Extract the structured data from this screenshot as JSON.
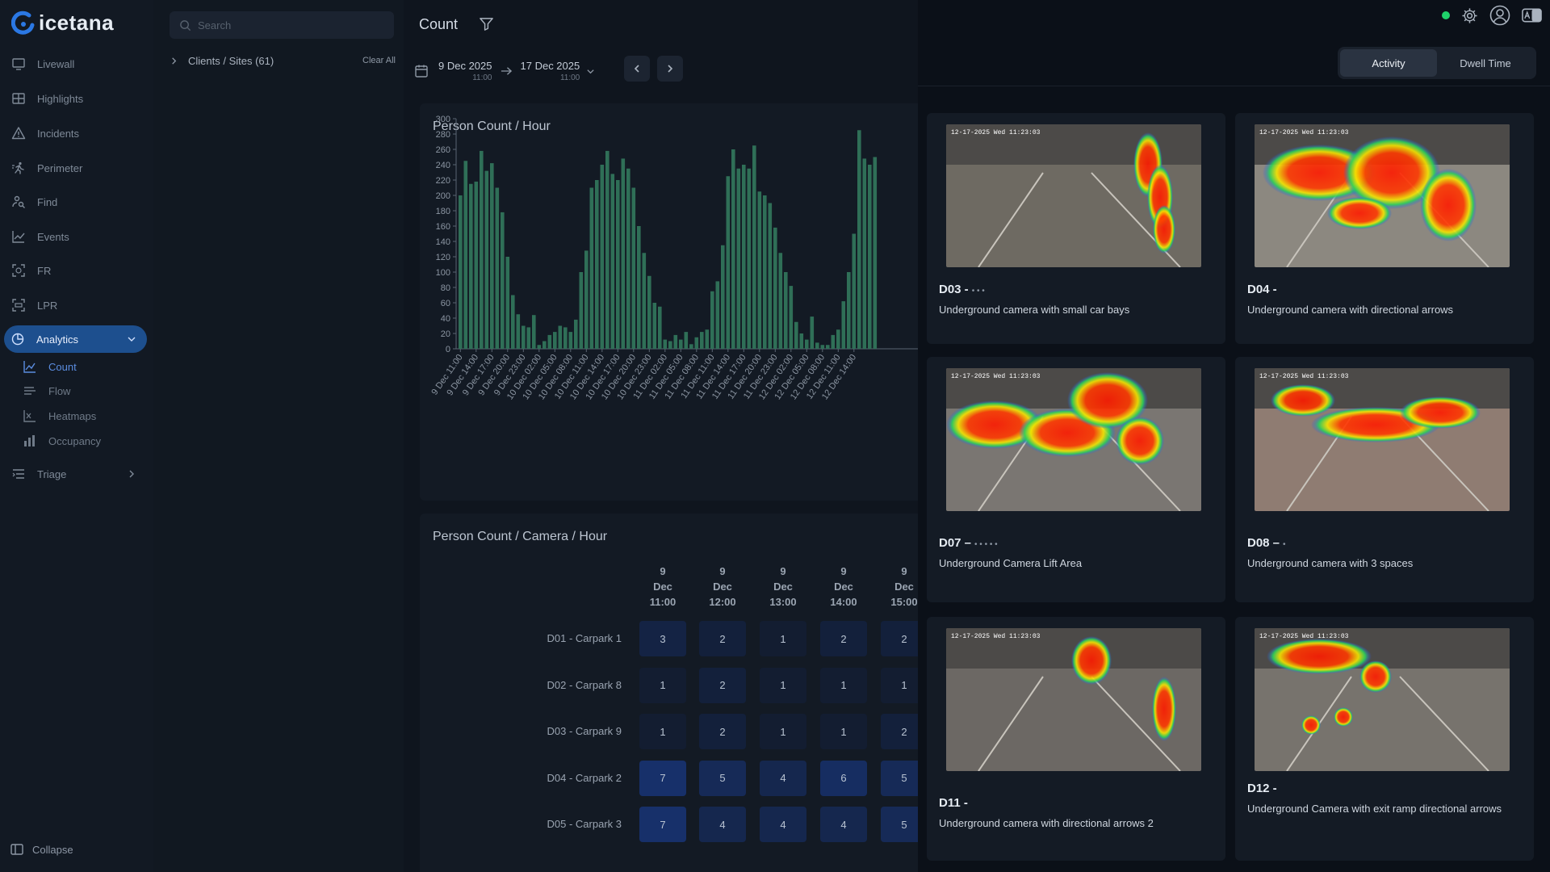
{
  "app": {
    "brand": "icetana"
  },
  "nav": {
    "items": [
      {
        "label": "Livewall",
        "icon": "monitor-icon"
      },
      {
        "label": "Highlights",
        "icon": "grid-icon"
      },
      {
        "label": "Incidents",
        "icon": "warning-icon"
      },
      {
        "label": "Perimeter",
        "icon": "person-run-icon"
      },
      {
        "label": "Find",
        "icon": "person-search-icon"
      },
      {
        "label": "Events",
        "icon": "trend-icon"
      },
      {
        "label": "FR",
        "icon": "face-scan-icon"
      },
      {
        "label": "LPR",
        "icon": "plate-scan-icon"
      },
      {
        "label": "Analytics",
        "icon": "pie-icon"
      }
    ],
    "analytics_sub": [
      {
        "label": "Count",
        "icon": "line-chart-icon"
      },
      {
        "label": "Flow",
        "icon": "flow-icon"
      },
      {
        "label": "Heatmaps",
        "icon": "heatmap-icon"
      },
      {
        "label": "Occupancy",
        "icon": "bar-chart-icon"
      }
    ],
    "triage": "Triage",
    "collapse": "Collapse"
  },
  "filters": {
    "search_placeholder": "Search",
    "clients_sites": "Clients / Sites (61)",
    "clear_all": "Clear All"
  },
  "main": {
    "title": "Count",
    "date_start": "9 Dec 2025",
    "time_start": "11:00",
    "date_end": "17 Dec 2025",
    "time_end": "11:00",
    "chart_title": "Person Count / Hour",
    "table_title": "Person Count / Camera / Hour"
  },
  "chart_data": {
    "type": "bar",
    "title": "Person Count / Hour",
    "ylim": [
      0,
      300
    ],
    "yticks": [
      0,
      20,
      40,
      60,
      80,
      100,
      120,
      140,
      160,
      180,
      200,
      220,
      240,
      260,
      280,
      300
    ],
    "x_tick_labels": [
      "9 Dec 11:00",
      "9 Dec 14:00",
      "9 Dec 17:00",
      "9 Dec 20:00",
      "9 Dec 23:00",
      "10 Dec 02:00",
      "10 Dec 05:00",
      "10 Dec 08:00",
      "10 Dec 11:00",
      "10 Dec 14:00",
      "10 Dec 17:00",
      "10 Dec 20:00",
      "10 Dec 23:00",
      "11 Dec 02:00",
      "11 Dec 05:00",
      "11 Dec 08:00",
      "11 Dec 11:00",
      "11 Dec 14:00",
      "11 Dec 17:00",
      "11 Dec 20:00",
      "11 Dec 23:00",
      "12 Dec 02:00",
      "12 Dec 05:00",
      "12 Dec 08:00",
      "12 Dec 11:00",
      "12 Dec 14:00"
    ],
    "values": [
      200,
      245,
      215,
      218,
      258,
      232,
      242,
      210,
      178,
      120,
      70,
      45,
      30,
      28,
      44,
      5,
      10,
      18,
      22,
      30,
      28,
      22,
      38,
      100,
      128,
      210,
      220,
      240,
      258,
      228,
      220,
      248,
      235,
      210,
      160,
      125,
      95,
      60,
      55,
      12,
      10,
      18,
      12,
      22,
      6,
      15,
      22,
      25,
      75,
      88,
      135,
      225,
      260,
      235,
      240,
      235,
      265,
      205,
      200,
      190,
      158,
      125,
      100,
      82,
      35,
      20,
      12,
      42,
      8,
      5,
      5,
      18,
      25,
      62,
      100,
      150,
      285,
      248,
      240,
      250
    ],
    "grid": false
  },
  "table": {
    "columns": [
      {
        "day": "9",
        "month": "Dec",
        "time": "11:00"
      },
      {
        "day": "9",
        "month": "Dec",
        "time": "12:00"
      },
      {
        "day": "9",
        "month": "Dec",
        "time": "13:00"
      },
      {
        "day": "9",
        "month": "Dec",
        "time": "14:00"
      },
      {
        "day": "9",
        "month": "Dec",
        "time": "15:00"
      }
    ],
    "rows": [
      {
        "label": "D01 - Carpark 1",
        "values": [
          3,
          2,
          1,
          2,
          2
        ]
      },
      {
        "label": "D02 - Carpark 8",
        "values": [
          1,
          2,
          1,
          1,
          1
        ]
      },
      {
        "label": "D03 - Carpark 9",
        "values": [
          1,
          2,
          1,
          1,
          2
        ]
      },
      {
        "label": "D04 - Carpark 2",
        "values": [
          7,
          5,
          4,
          6,
          5
        ]
      },
      {
        "label": "D05 - Carpark 3",
        "values": [
          7,
          4,
          4,
          4,
          5
        ]
      }
    ]
  },
  "overlay": {
    "tabs": [
      "Activity",
      "Dwell Time"
    ],
    "active_tab": "Activity",
    "cameras": [
      {
        "title": "D03 -",
        "extra": "• • •",
        "desc": "Underground camera with small car bays"
      },
      {
        "title": "D04 -",
        "extra": "",
        "desc": "Underground camera with directional arrows"
      },
      {
        "title": "D07 –",
        "extra": "• • •  •  •",
        "desc": "Underground Camera Lift Area"
      },
      {
        "title": "D08 –",
        "extra": "•",
        "desc": "Underground camera with 3 spaces"
      },
      {
        "title": "D11 -",
        "extra": "",
        "desc": "Underground camera with directional arrows 2"
      },
      {
        "title": "D12 -",
        "extra": "",
        "desc": "Underground Camera with exit ramp directional arrows"
      }
    ],
    "thumb_timestamp": "12-17-2025 Wed 11:23:03"
  },
  "colors": {
    "accent": "#1d4f8e",
    "bar": "#2f6f57",
    "status_ok": "#1fd26a",
    "cell_low": "#121c2e",
    "cell_high": "#17306a"
  }
}
